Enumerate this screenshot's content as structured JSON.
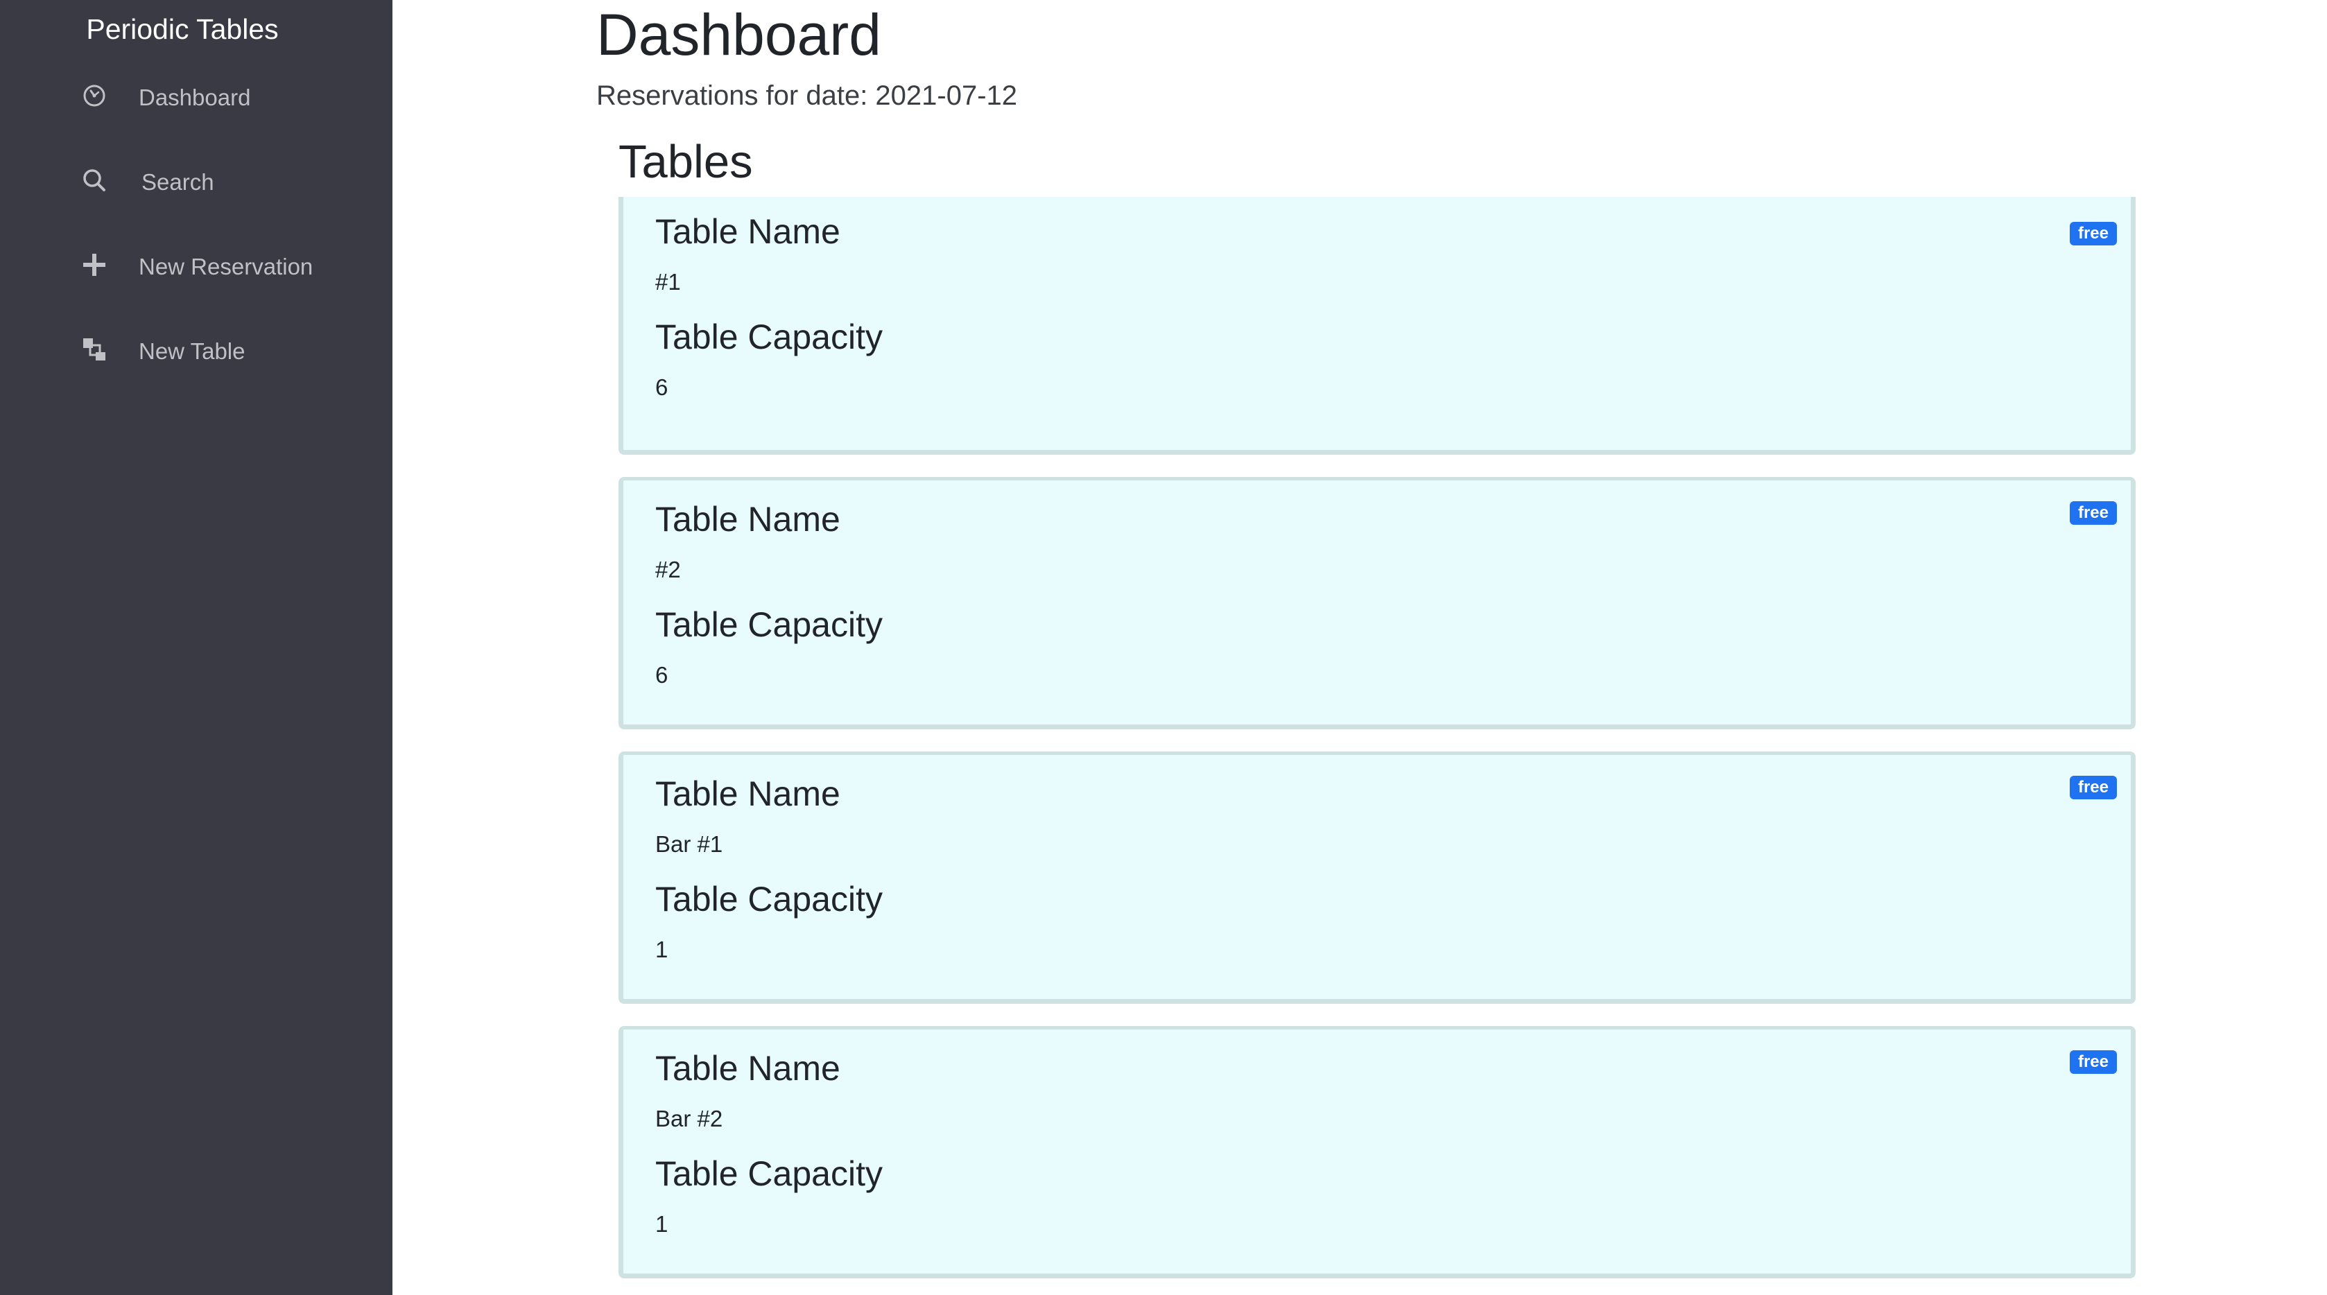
{
  "sidebar": {
    "brand": "Periodic Tables",
    "items": [
      {
        "label": "Dashboard",
        "icon": "dashboard-gauge-icon"
      },
      {
        "label": "Search",
        "icon": "search-icon"
      },
      {
        "label": "New Reservation",
        "icon": "plus-icon"
      },
      {
        "label": "New Table",
        "icon": "layers-icon"
      }
    ]
  },
  "main": {
    "title": "Dashboard",
    "reservations_line": "Reservations for date: 2021-07-12",
    "tables_heading": "Tables",
    "tables": [
      {
        "name_heading": "Table Name",
        "name": "#1",
        "capacity_heading": "Table Capacity",
        "capacity": "6",
        "status": "free"
      },
      {
        "name_heading": "Table Name",
        "name": "#2",
        "capacity_heading": "Table Capacity",
        "capacity": "6",
        "status": "free"
      },
      {
        "name_heading": "Table Name",
        "name": "Bar #1",
        "capacity_heading": "Table Capacity",
        "capacity": "1",
        "status": "free"
      },
      {
        "name_heading": "Table Name",
        "name": "Bar #2",
        "capacity_heading": "Table Capacity",
        "capacity": "1",
        "status": "free"
      }
    ]
  },
  "colors": {
    "sidebar_bg": "#393a43",
    "card_bg": "#e8fcfe",
    "card_border": "#cfe2e2",
    "badge_bg": "#1f73f0"
  }
}
